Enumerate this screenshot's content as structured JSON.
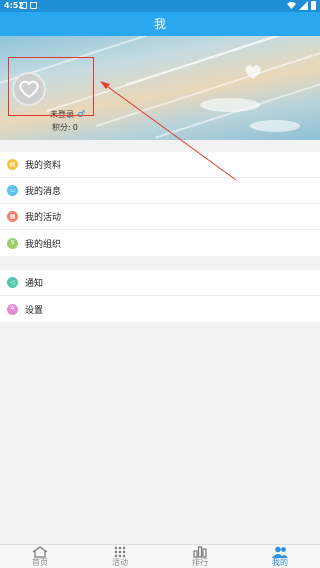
{
  "status_bar": {
    "time": "4:52"
  },
  "title_bar": {
    "title": "我"
  },
  "profile": {
    "username": "未登录",
    "gender_symbol": "♂",
    "points_label": "积分:",
    "points_value": "0"
  },
  "menu_group_1": [
    {
      "label": "我的资料",
      "icon": "profile-icon",
      "color": "#f5c342"
    },
    {
      "label": "我的消息",
      "icon": "message-icon",
      "color": "#5bc3e8"
    },
    {
      "label": "我的活动",
      "icon": "activity-icon",
      "color": "#f0826e"
    },
    {
      "label": "我的组织",
      "icon": "organization-icon",
      "color": "#9ccf6a"
    }
  ],
  "menu_group_2": [
    {
      "label": "通知",
      "icon": "notification-icon",
      "color": "#52c7b0"
    },
    {
      "label": "设置",
      "icon": "settings-icon",
      "color": "#e78ad6"
    }
  ],
  "bottom_nav": [
    {
      "label": "首页",
      "icon": "home-icon",
      "active": false
    },
    {
      "label": "活动",
      "icon": "grid-icon",
      "active": false
    },
    {
      "label": "排行",
      "icon": "ranking-icon",
      "active": false
    },
    {
      "label": "我的",
      "icon": "users-icon",
      "active": true
    }
  ],
  "colors": {
    "accent": "#29a8f0",
    "active_tab": "#2f8fe0",
    "annotation": "#e53935"
  }
}
